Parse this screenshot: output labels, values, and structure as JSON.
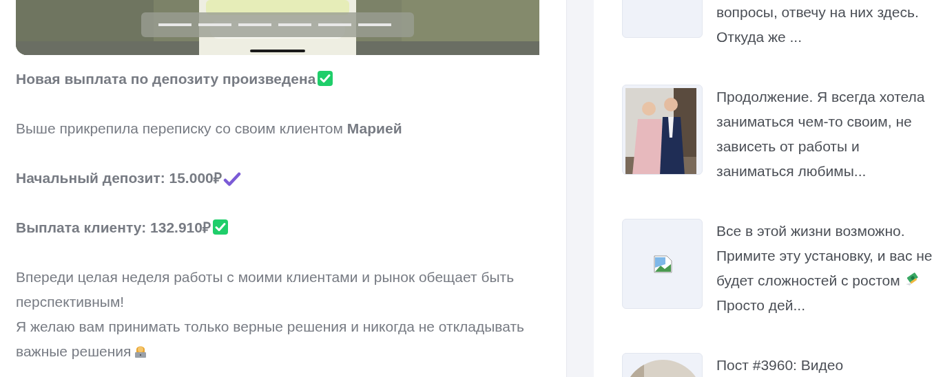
{
  "post": {
    "paragraphs": [
      {
        "kind": "strong",
        "lines": [
          "Новая выплата по депозиту произведена"
        ],
        "badge": {
          "kind": "green_check"
        }
      },
      {
        "kind": "plain",
        "lines": [
          "Выше прикрепила переписку со своим клиентом **Марией**"
        ]
      },
      {
        "kind": "strong",
        "lines": [
          "Начальный депозит: 15.000₽"
        ],
        "badge": {
          "kind": "purple_check"
        }
      },
      {
        "kind": "strong",
        "lines": [
          "Выплата клиенту: 132.910₽"
        ],
        "badge": {
          "kind": "green_check"
        }
      },
      {
        "kind": "plain",
        "lines": [
          "Впереди целая неделя работы с моими клиентами и рынок обещает быть перспективным!",
          "Я желаю вам принимать только верные решения и никогда не откладывать важные решения"
        ],
        "badge": {
          "kind": "technologist"
        }
      }
    ]
  },
  "related": [
    {
      "kind": "blank",
      "text": "вопросы, отвечу на них здесь. Откуда же ..."
    },
    {
      "text": "Продолжение. Я всегда хотела заниматься чем-то своим, не зависеть от работы и заниматься любимы..."
    },
    {
      "kind": "broken",
      "text": "Все в этой жизни возможно. Примите эту установку, и вас не будет сложностей с ростом",
      "badge": {
        "kind": "money"
      },
      "text_after": "Просто дей..."
    },
    {
      "kind": "video",
      "text": "Пост #3960: Видео"
    }
  ]
}
